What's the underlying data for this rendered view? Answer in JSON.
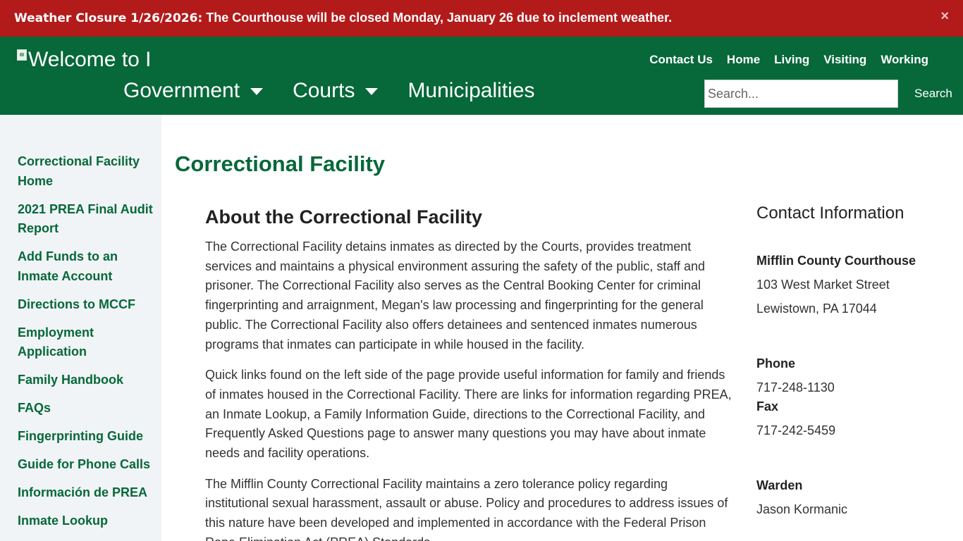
{
  "alert": {
    "label": "Weather Closure 1/26/2026:",
    "message": " The Courthouse will be closed Monday, January 26 due to inclement weather.",
    "close_symbol": "×"
  },
  "header": {
    "logo_alt": "Welcome to I",
    "main_nav": [
      {
        "label": "Government",
        "has_dropdown": true
      },
      {
        "label": "Courts",
        "has_dropdown": true
      },
      {
        "label": "Municipalities",
        "has_dropdown": false
      }
    ],
    "util_nav": [
      "Contact Us",
      "Home",
      "Living",
      "Visiting",
      "Working"
    ],
    "search": {
      "placeholder": "Search...",
      "button_label": "Search"
    }
  },
  "sidebar": {
    "items": [
      "Correctional Facility Home",
      "2021 PREA Final Audit Report",
      "Add Funds to an Inmate Account",
      "Directions to MCCF",
      "Employment Application",
      "Family Handbook",
      "FAQs",
      "Fingerprinting Guide",
      "Guide for Phone Calls",
      "Información de PREA",
      "Inmate Lookup"
    ]
  },
  "main": {
    "page_title": "Correctional Facility",
    "heading": "About the Correctional Facility",
    "paragraphs": [
      "The Correctional Facility detains inmates as directed by the Courts, provides treatment services and maintains a physical environment assuring the safety of the public, staff and prisoner.  The Correctional Facility also serves as the Central Booking Center for criminal fingerprinting and arraignment, Megan's law processing and fingerprinting for the general public.  The Correctional Facility also offers detainees and sentenced inmates numerous programs that inmates can participate in while housed in the facility.",
      "Quick links found on the left side of the page provide useful information for family and friends of inmates housed in the Correctional Facility.  There are links for information regarding PREA, an Inmate Lookup, a Family Information Guide, directions to the Correctional Facility, and Frequently Asked Questions page to answer many questions you may have about inmate needs and facility operations.",
      "The Mifflin County Correctional Facility maintains a zero tolerance policy regarding institutional sexual harassment, assault or abuse. Policy and procedures to address issues of this nature have been developed and implemented in accordance with the Federal Prison Rape Elimination Act (PREA) Standards."
    ]
  },
  "contact": {
    "title": "Contact Information",
    "location_label": "Mifflin County Courthouse",
    "address_line1": "103 West Market Street",
    "address_line2": "Lewistown, PA 17044",
    "phone_label": "Phone",
    "phone": "717-248-1130",
    "fax_label": "Fax",
    "fax": "717-242-5459",
    "warden_label": "Warden",
    "warden": "Jason Kormanic"
  },
  "colors": {
    "alert_bg": "#b31b1b",
    "header_bg": "#07683a",
    "link_green": "#07683a",
    "sidebar_bg": "#f1f4f6"
  }
}
